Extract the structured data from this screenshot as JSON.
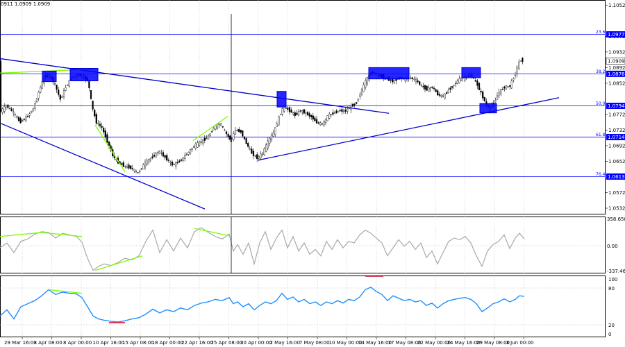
{
  "header": {
    "ohlc_text": "0911 1.0909 1.0909"
  },
  "chart_data": {
    "type": "candlestick",
    "symbol_readout": "0911 1.0909 1.0909",
    "current_price": 1.0909,
    "price_panel": {
      "ylim": [
        1.0516,
        1.1065
      ],
      "ticks": [
        "1.1052",
        "1.0972",
        "1.0932",
        "1.0892",
        "1.0852",
        "1.0772",
        "1.0732",
        "1.0692",
        "1.0652",
        "1.0572",
        "1.0532"
      ],
      "fib_levels": [
        {
          "tag": "23.6",
          "price": 1.0977,
          "label": "1.0977"
        },
        {
          "tag": "38.2",
          "price": 1.0876,
          "label": "1.0876"
        },
        {
          "tag": "50.0",
          "price": 1.0794,
          "label": "1.0794"
        },
        {
          "tag": "61.8",
          "price": 1.0714,
          "label": "1.0714"
        },
        {
          "tag": "76.4",
          "price": 1.0613,
          "label": "1.0613"
        }
      ],
      "trend_lines": [
        {
          "from": [
            0,
            1.0915
          ],
          "to": [
            560,
            1.0775
          ]
        },
        {
          "from": [
            0,
            1.075
          ],
          "to": [
            295,
            1.053
          ]
        },
        {
          "from": [
            372,
            1.0655
          ],
          "to": [
            805,
            1.0815
          ]
        }
      ],
      "divergence_lines": [
        {
          "from": [
            0,
            1.0878
          ],
          "to": [
            133,
            1.0888
          ]
        },
        {
          "from": [
            137,
            1.0745
          ],
          "to": [
            180,
            1.0625
          ]
        },
        {
          "from": [
            278,
            1.0705
          ],
          "to": [
            328,
            1.0767
          ]
        }
      ],
      "boxes": [
        {
          "x": [
            61,
            81
          ],
          "y": [
            1.0883,
            1.0856
          ]
        },
        {
          "x": [
            101,
            141
          ],
          "y": [
            1.089,
            1.0858
          ]
        },
        {
          "x": [
            399,
            412
          ],
          "y": [
            1.0831,
            1.0791
          ]
        },
        {
          "x": [
            531,
            589
          ],
          "y": [
            1.0892,
            1.0863
          ]
        },
        {
          "x": [
            665,
            692
          ],
          "y": [
            1.0892,
            1.0866
          ]
        },
        {
          "x": [
            691,
            715
          ],
          "y": [
            1.08,
            1.0776
          ]
        }
      ]
    },
    "cci_panel": {
      "max_label": "358.6587",
      "zero_label": "0.00",
      "min_label": "-337.462",
      "ylim": [
        -337.462,
        358.6587
      ]
    },
    "rsi_panel": {
      "ticks": [
        "100",
        "80",
        "20",
        "0"
      ],
      "ylim": [
        0,
        100
      ],
      "overbought": 80,
      "oversold": 20
    },
    "x_labels": [
      "29 Mar 16:00",
      "3 Apr 08:00",
      "8 Apr 00:00",
      "10 Apr 16:00",
      "15 Apr 08:00",
      "18 Apr 00:00",
      "22 Apr 16:00",
      "25 Apr 08:00",
      "30 Apr 00:00",
      "2 May 16:00",
      "7 May 08:00",
      "10 May 00:00",
      "14 May 16:00",
      "17 May 08:00",
      "22 May 00:00",
      "24 May 16:00",
      "29 May 08:00",
      "3 Jun 00:00"
    ],
    "price_path": [
      [
        0,
        1.0775
      ],
      [
        10,
        1.0795
      ],
      [
        20,
        1.0778
      ],
      [
        30,
        1.0752
      ],
      [
        40,
        1.0765
      ],
      [
        50,
        1.079
      ],
      [
        58,
        1.0835
      ],
      [
        65,
        1.0868
      ],
      [
        72,
        1.0873
      ],
      [
        80,
        1.085
      ],
      [
        88,
        1.081
      ],
      [
        96,
        1.0842
      ],
      [
        104,
        1.0866
      ],
      [
        112,
        1.0874
      ],
      [
        120,
        1.087
      ],
      [
        128,
        1.0858
      ],
      [
        134,
        1.079
      ],
      [
        140,
        1.0752
      ],
      [
        148,
        1.0738
      ],
      [
        156,
        1.0702
      ],
      [
        164,
        1.0665
      ],
      [
        172,
        1.0648
      ],
      [
        180,
        1.064
      ],
      [
        190,
        1.0635
      ],
      [
        200,
        1.0622
      ],
      [
        210,
        1.0648
      ],
      [
        220,
        1.0662
      ],
      [
        230,
        1.0678
      ],
      [
        240,
        1.066
      ],
      [
        250,
        1.0642
      ],
      [
        260,
        1.0652
      ],
      [
        270,
        1.067
      ],
      [
        280,
        1.069
      ],
      [
        290,
        1.0702
      ],
      [
        300,
        1.0712
      ],
      [
        310,
        1.074
      ],
      [
        318,
        1.075
      ],
      [
        326,
        1.0725
      ],
      [
        334,
        1.0705
      ],
      [
        340,
        1.0732
      ],
      [
        348,
        1.0728
      ],
      [
        356,
        1.0698
      ],
      [
        364,
        1.0672
      ],
      [
        372,
        1.066
      ],
      [
        380,
        1.0675
      ],
      [
        388,
        1.0705
      ],
      [
        396,
        1.0728
      ],
      [
        404,
        1.0772
      ],
      [
        410,
        1.0792
      ],
      [
        418,
        1.0782
      ],
      [
        426,
        1.077
      ],
      [
        434,
        1.0782
      ],
      [
        442,
        1.0775
      ],
      [
        450,
        1.0765
      ],
      [
        458,
        1.075
      ],
      [
        466,
        1.0748
      ],
      [
        474,
        1.077
      ],
      [
        482,
        1.0775
      ],
      [
        490,
        1.0782
      ],
      [
        498,
        1.078
      ],
      [
        506,
        1.0792
      ],
      [
        514,
        1.08
      ],
      [
        520,
        1.0826
      ],
      [
        528,
        1.0858
      ],
      [
        536,
        1.088
      ],
      [
        544,
        1.0876
      ],
      [
        552,
        1.0868
      ],
      [
        560,
        1.0862
      ],
      [
        568,
        1.0856
      ],
      [
        576,
        1.0866
      ],
      [
        584,
        1.0862
      ],
      [
        592,
        1.0866
      ],
      [
        600,
        1.086
      ],
      [
        608,
        1.0845
      ],
      [
        616,
        1.0836
      ],
      [
        624,
        1.0842
      ],
      [
        632,
        1.0822
      ],
      [
        640,
        1.0818
      ],
      [
        648,
        1.0836
      ],
      [
        656,
        1.085
      ],
      [
        664,
        1.0864
      ],
      [
        672,
        1.0868
      ],
      [
        680,
        1.0872
      ],
      [
        688,
        1.085
      ],
      [
        696,
        1.0818
      ],
      [
        704,
        1.0788
      ],
      [
        712,
        1.08
      ],
      [
        720,
        1.083
      ],
      [
        728,
        1.0842
      ],
      [
        736,
        1.0845
      ],
      [
        744,
        1.0882
      ],
      [
        750,
        1.0912
      ],
      [
        755,
        1.0909
      ]
    ],
    "cci_path": [
      [
        0,
        -20
      ],
      [
        10,
        40
      ],
      [
        20,
        -80
      ],
      [
        30,
        60
      ],
      [
        40,
        90
      ],
      [
        50,
        150
      ],
      [
        60,
        180
      ],
      [
        70,
        170
      ],
      [
        80,
        100
      ],
      [
        90,
        160
      ],
      [
        100,
        140
      ],
      [
        110,
        120
      ],
      [
        118,
        50
      ],
      [
        126,
        -150
      ],
      [
        134,
        -300
      ],
      [
        142,
        -250
      ],
      [
        150,
        -220
      ],
      [
        160,
        -240
      ],
      [
        170,
        -200
      ],
      [
        180,
        -150
      ],
      [
        190,
        -170
      ],
      [
        200,
        -120
      ],
      [
        210,
        60
      ],
      [
        220,
        200
      ],
      [
        230,
        -80
      ],
      [
        240,
        80
      ],
      [
        250,
        -60
      ],
      [
        260,
        100
      ],
      [
        270,
        -20
      ],
      [
        280,
        180
      ],
      [
        290,
        230
      ],
      [
        300,
        170
      ],
      [
        310,
        120
      ],
      [
        320,
        90
      ],
      [
        330,
        150
      ],
      [
        336,
        -60
      ],
      [
        342,
        20
      ],
      [
        350,
        -100
      ],
      [
        358,
        40
      ],
      [
        366,
        -220
      ],
      [
        374,
        40
      ],
      [
        382,
        180
      ],
      [
        390,
        -40
      ],
      [
        398,
        100
      ],
      [
        406,
        200
      ],
      [
        414,
        -20
      ],
      [
        422,
        120
      ],
      [
        430,
        -60
      ],
      [
        438,
        40
      ],
      [
        446,
        -100
      ],
      [
        454,
        -40
      ],
      [
        462,
        -120
      ],
      [
        470,
        60
      ],
      [
        478,
        -40
      ],
      [
        486,
        80
      ],
      [
        494,
        -20
      ],
      [
        502,
        60
      ],
      [
        510,
        40
      ],
      [
        518,
        140
      ],
      [
        526,
        200
      ],
      [
        534,
        160
      ],
      [
        542,
        100
      ],
      [
        550,
        40
      ],
      [
        558,
        -120
      ],
      [
        566,
        -20
      ],
      [
        574,
        80
      ],
      [
        582,
        0
      ],
      [
        590,
        60
      ],
      [
        598,
        -40
      ],
      [
        606,
        40
      ],
      [
        614,
        -140
      ],
      [
        622,
        -60
      ],
      [
        630,
        -220
      ],
      [
        638,
        -80
      ],
      [
        646,
        60
      ],
      [
        654,
        100
      ],
      [
        662,
        80
      ],
      [
        670,
        120
      ],
      [
        678,
        40
      ],
      [
        686,
        -120
      ],
      [
        694,
        -250
      ],
      [
        702,
        -60
      ],
      [
        710,
        20
      ],
      [
        718,
        60
      ],
      [
        726,
        140
      ],
      [
        734,
        -30
      ],
      [
        742,
        100
      ],
      [
        748,
        160
      ],
      [
        755,
        90
      ]
    ],
    "rsi_path": [
      [
        0,
        35
      ],
      [
        10,
        45
      ],
      [
        20,
        30
      ],
      [
        30,
        50
      ],
      [
        40,
        55
      ],
      [
        50,
        60
      ],
      [
        60,
        68
      ],
      [
        70,
        78
      ],
      [
        80,
        70
      ],
      [
        90,
        74
      ],
      [
        100,
        72
      ],
      [
        110,
        71
      ],
      [
        118,
        65
      ],
      [
        126,
        50
      ],
      [
        134,
        35
      ],
      [
        142,
        30
      ],
      [
        150,
        28
      ],
      [
        160,
        26
      ],
      [
        170,
        25
      ],
      [
        180,
        27
      ],
      [
        190,
        30
      ],
      [
        200,
        32
      ],
      [
        210,
        38
      ],
      [
        220,
        46
      ],
      [
        230,
        40
      ],
      [
        240,
        45
      ],
      [
        250,
        42
      ],
      [
        260,
        48
      ],
      [
        270,
        45
      ],
      [
        280,
        52
      ],
      [
        290,
        56
      ],
      [
        300,
        58
      ],
      [
        310,
        62
      ],
      [
        320,
        60
      ],
      [
        330,
        65
      ],
      [
        336,
        55
      ],
      [
        342,
        58
      ],
      [
        350,
        50
      ],
      [
        358,
        55
      ],
      [
        366,
        45
      ],
      [
        374,
        52
      ],
      [
        382,
        58
      ],
      [
        390,
        55
      ],
      [
        398,
        60
      ],
      [
        406,
        72
      ],
      [
        414,
        62
      ],
      [
        422,
        66
      ],
      [
        430,
        58
      ],
      [
        438,
        62
      ],
      [
        446,
        55
      ],
      [
        454,
        58
      ],
      [
        462,
        52
      ],
      [
        470,
        58
      ],
      [
        478,
        55
      ],
      [
        486,
        60
      ],
      [
        494,
        56
      ],
      [
        502,
        62
      ],
      [
        510,
        60
      ],
      [
        518,
        66
      ],
      [
        526,
        78
      ],
      [
        534,
        82
      ],
      [
        542,
        75
      ],
      [
        550,
        70
      ],
      [
        558,
        60
      ],
      [
        566,
        68
      ],
      [
        574,
        64
      ],
      [
        582,
        60
      ],
      [
        590,
        62
      ],
      [
        598,
        58
      ],
      [
        606,
        60
      ],
      [
        614,
        52
      ],
      [
        622,
        56
      ],
      [
        630,
        48
      ],
      [
        638,
        55
      ],
      [
        646,
        60
      ],
      [
        654,
        62
      ],
      [
        662,
        64
      ],
      [
        670,
        65
      ],
      [
        678,
        62
      ],
      [
        686,
        55
      ],
      [
        694,
        42
      ],
      [
        702,
        48
      ],
      [
        710,
        55
      ],
      [
        718,
        58
      ],
      [
        726,
        63
      ],
      [
        734,
        58
      ],
      [
        742,
        62
      ],
      [
        748,
        68
      ],
      [
        755,
        67
      ]
    ],
    "cci_divergence_lines": [
      {
        "from": [
          0,
          120
        ],
        "to": [
          60,
          170
        ]
      },
      {
        "from": [
          60,
          170
        ],
        "to": [
          118,
          120
        ]
      },
      {
        "from": [
          137,
          -300
        ],
        "to": [
          205,
          -120
        ]
      },
      {
        "from": [
          280,
          220
        ],
        "to": [
          330,
          130
        ]
      }
    ],
    "rsi_divergence_lines": [
      {
        "from": [
          70,
          78
        ],
        "to": [
          118,
          72
        ]
      }
    ],
    "rsi_marks": [
      {
        "from": [
          157,
          24
        ],
        "to": [
          180,
          24
        ]
      },
      {
        "from": [
          526,
          100
        ],
        "to": [
          552,
          100
        ]
      }
    ]
  }
}
